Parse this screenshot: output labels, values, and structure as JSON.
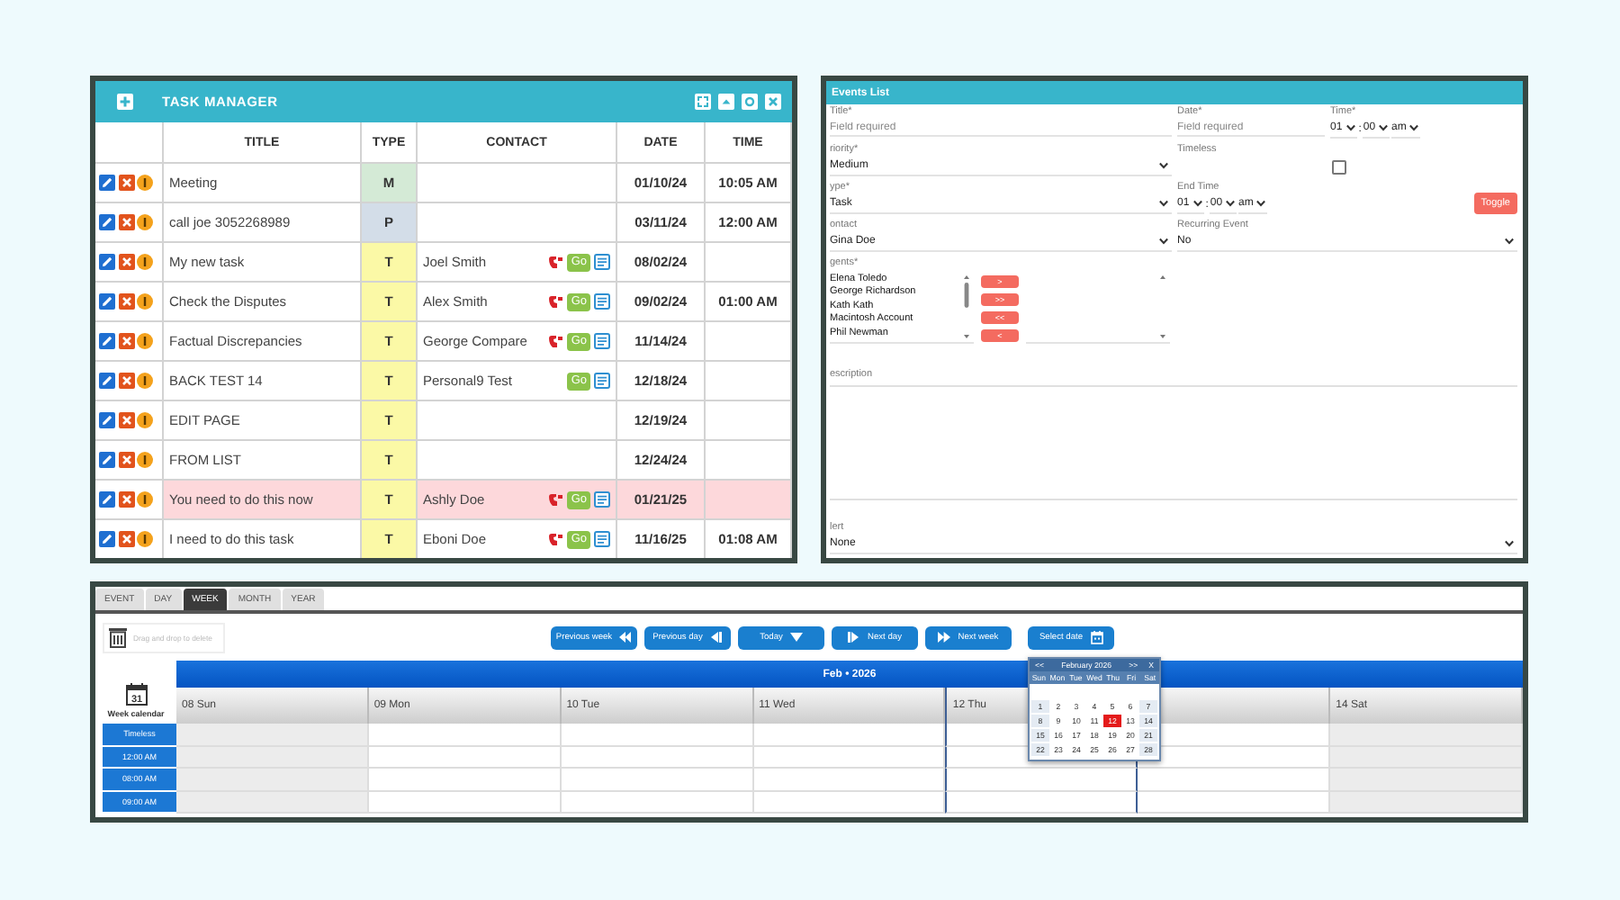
{
  "task_manager": {
    "title": "TASK MANAGER",
    "columns": [
      "TITLE",
      "TYPE",
      "CONTACT",
      "DATE",
      "TIME"
    ],
    "rows": [
      {
        "title": "Meeting",
        "type": "M",
        "color": "#d4ead6",
        "call_icon": false,
        "notes_icon": false,
        "date": "01/10/24",
        "time": "10:05 AM",
        "highlighted": false
      },
      {
        "title": "call joe 3052268989",
        "type": "P",
        "color": "#d3dde8",
        "call_icon": false,
        "notes_icon": false,
        "date": "03/11/24",
        "time": "12:00 AM",
        "highlighted": false
      },
      {
        "title": "My new task",
        "type": "T",
        "color": "#fbf9a6",
        "contact": "Joel Smith",
        "call_icon": true,
        "go": "Go",
        "notes_icon": true,
        "date": "08/02/24",
        "highlighted": false
      },
      {
        "title": "Check the Disputes",
        "type": "T",
        "color": "#fbf9a6",
        "contact": "Alex Smith",
        "call_icon": true,
        "go": "Go",
        "notes_icon": true,
        "date": "09/02/24",
        "time": "01:00 AM",
        "highlighted": false
      },
      {
        "title": "Factual Discrepancies",
        "type": "T",
        "color": "#fbf9a6",
        "contact": "George Compare",
        "call_icon": true,
        "go": "Go",
        "notes_icon": true,
        "date": "11/14/24",
        "highlighted": false
      },
      {
        "title": "BACK TEST 14",
        "type": "T",
        "color": "#fbf9a6",
        "contact": "Personal9 Test",
        "call_icon": false,
        "go": "Go",
        "notes_icon": true,
        "date": "12/18/24",
        "highlighted": false
      },
      {
        "title": "EDIT PAGE",
        "type": "T",
        "color": "#fbf9a6",
        "call_icon": false,
        "notes_icon": false,
        "date": "12/19/24",
        "highlighted": false
      },
      {
        "title": "FROM LIST",
        "type": "T",
        "color": "#fbf9a6",
        "call_icon": false,
        "notes_icon": false,
        "date": "12/24/24",
        "highlighted": false
      },
      {
        "title": "You need to do this now",
        "type": "T",
        "color": "#fbf9a6",
        "contact": "Ashly Doe",
        "call_icon": true,
        "go": "Go",
        "notes_icon": true,
        "date": "01/21/25",
        "highlighted": true
      },
      {
        "title": "I need to do this task",
        "type": "T",
        "color": "#fbf9a6",
        "contact": "Eboni Doe",
        "call_icon": true,
        "go": "Go",
        "notes_icon": true,
        "date": "11/16/25",
        "time": "01:08 AM",
        "highlighted": false
      }
    ]
  },
  "events_list": {
    "title": "Events List",
    "title_field": {
      "label": "Title*",
      "placeholder": "Field required"
    },
    "date_field": {
      "label": "Date*",
      "placeholder": "Field required"
    },
    "time": {
      "label": "Time*",
      "hour": "01",
      "separator": ":",
      "minute": "00",
      "ampm": "am"
    },
    "priority": {
      "label": "riority*",
      "value": "Medium"
    },
    "timeless": {
      "label": "Timeless",
      "checked": false
    },
    "type": {
      "label": "ype*",
      "value": "Task"
    },
    "end_time": {
      "label": "End Time",
      "hour": "01",
      "separator": ":",
      "minute": "00",
      "ampm": "am"
    },
    "toggle_button": "Toggle",
    "contact": {
      "label": "ontact",
      "value": "Gina Doe"
    },
    "recurring": {
      "label": "Recurring Event",
      "value": "No"
    },
    "agents": {
      "label": "gents*",
      "available": [
        "Elena Toledo",
        "George Richardson",
        "Kath Kath",
        "Macintosh Account",
        "Phil Newman"
      ],
      "transfer_buttons": [
        ">",
        ">>",
        "<<",
        "<"
      ]
    },
    "description": {
      "label": "escription"
    },
    "alert": {
      "label": "lert",
      "value": "None"
    }
  },
  "calendar": {
    "tabs": [
      {
        "label": "EVENT",
        "selected": false
      },
      {
        "label": "DAY",
        "selected": false
      },
      {
        "label": "WEEK",
        "selected": true
      },
      {
        "label": "MONTH",
        "selected": false
      },
      {
        "label": "YEAR",
        "selected": false
      }
    ],
    "trash_hint": "Drag and drop to delete",
    "nav_buttons": [
      {
        "label": "Previous week",
        "kind": "prev-week"
      },
      {
        "label": "Previous day",
        "kind": "prev-day"
      },
      {
        "label": "Today",
        "kind": "today"
      },
      {
        "label": "Next day",
        "kind": "next-day"
      },
      {
        "label": "Next week",
        "kind": "next-week"
      },
      {
        "label": "Select date",
        "kind": "select-date"
      }
    ],
    "calendar_icon_day": "31",
    "sidebar_label": "Week calendar",
    "month_bar": "Feb • 2026",
    "days": [
      {
        "label": "08 Sun",
        "weekend": true,
        "today": false
      },
      {
        "label": "09 Mon",
        "weekend": false,
        "today": false
      },
      {
        "label": "10 Tue",
        "weekend": false,
        "today": false
      },
      {
        "label": "11 Wed",
        "weekend": false,
        "today": false
      },
      {
        "label": "12 Thu",
        "weekend": false,
        "today": true
      },
      {
        "weekend": false,
        "today": false
      },
      {
        "label": "14 Sat",
        "weekend": true,
        "today": false
      }
    ],
    "time_slots": [
      "Timeless",
      "12:00 AM",
      "08:00 AM",
      "09:00 AM"
    ],
    "date_picker": {
      "prev": "<<",
      "title": "February 2026",
      "next": ">>",
      "close": "X",
      "weekdays": [
        "Sun",
        "Mon",
        "Tue",
        "Wed",
        "Thu",
        "Fri",
        "Sat"
      ],
      "days": [
        {
          "label": "1",
          "selected": false
        },
        {
          "label": "2",
          "selected": false
        },
        {
          "label": "3",
          "selected": false
        },
        {
          "label": "4",
          "selected": false
        },
        {
          "label": "5",
          "selected": false
        },
        {
          "label": "6",
          "selected": false
        },
        {
          "label": "7",
          "selected": false
        },
        {
          "label": "8",
          "selected": false
        },
        {
          "label": "9",
          "selected": false
        },
        {
          "label": "10",
          "selected": false
        },
        {
          "label": "11",
          "selected": false
        },
        {
          "label": "12",
          "selected": true
        },
        {
          "label": "13",
          "selected": false
        },
        {
          "label": "14",
          "selected": false
        },
        {
          "label": "15",
          "selected": false
        },
        {
          "label": "16",
          "selected": false
        },
        {
          "label": "17",
          "selected": false
        },
        {
          "label": "18",
          "selected": false
        },
        {
          "label": "19",
          "selected": false
        },
        {
          "label": "20",
          "selected": false
        },
        {
          "label": "21",
          "selected": false
        },
        {
          "label": "22",
          "selected": false
        },
        {
          "label": "23",
          "selected": false
        },
        {
          "label": "24",
          "selected": false
        },
        {
          "label": "25",
          "selected": false
        },
        {
          "label": "26",
          "selected": false
        },
        {
          "label": "27",
          "selected": false
        },
        {
          "label": "28",
          "selected": false
        }
      ]
    }
  }
}
